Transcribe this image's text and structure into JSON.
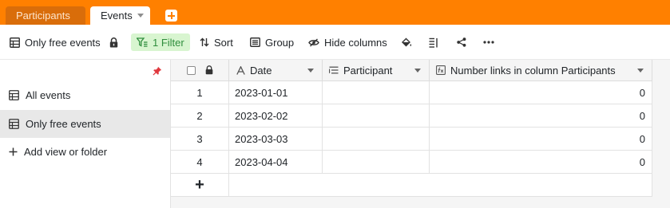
{
  "tabs": [
    {
      "label": "Participants",
      "active": false
    },
    {
      "label": "Events",
      "active": true
    }
  ],
  "toolbar": {
    "view_name": "Only free events",
    "filter_label": "1 Filter",
    "sort_label": "Sort",
    "group_label": "Group",
    "hide_columns_label": "Hide columns"
  },
  "sidebar": {
    "views": [
      {
        "label": "All events",
        "selected": false
      },
      {
        "label": "Only free events",
        "selected": true
      }
    ],
    "add_label": "Add view or folder"
  },
  "table": {
    "columns": [
      {
        "label": "Date",
        "type_icon": "text-type-icon"
      },
      {
        "label": "Participant",
        "type_icon": "link-type-icon"
      },
      {
        "label": "Number links in column Participants",
        "type_icon": "formula-type-icon"
      }
    ],
    "rows": [
      {
        "index": "1",
        "date": "2023-01-01",
        "participant": "",
        "links": "0"
      },
      {
        "index": "2",
        "date": "2023-02-02",
        "participant": "",
        "links": "0"
      },
      {
        "index": "3",
        "date": "2023-03-03",
        "participant": "",
        "links": "0"
      },
      {
        "index": "4",
        "date": "2023-04-04",
        "participant": "",
        "links": "0"
      }
    ],
    "add_row_symbol": "+"
  },
  "colors": {
    "tabbar": "#ff8000",
    "filter_bg": "#d8f5d0",
    "filter_text": "#2f8e3d",
    "selected_view": "#e8e8e8",
    "pin": "#e0383e"
  }
}
